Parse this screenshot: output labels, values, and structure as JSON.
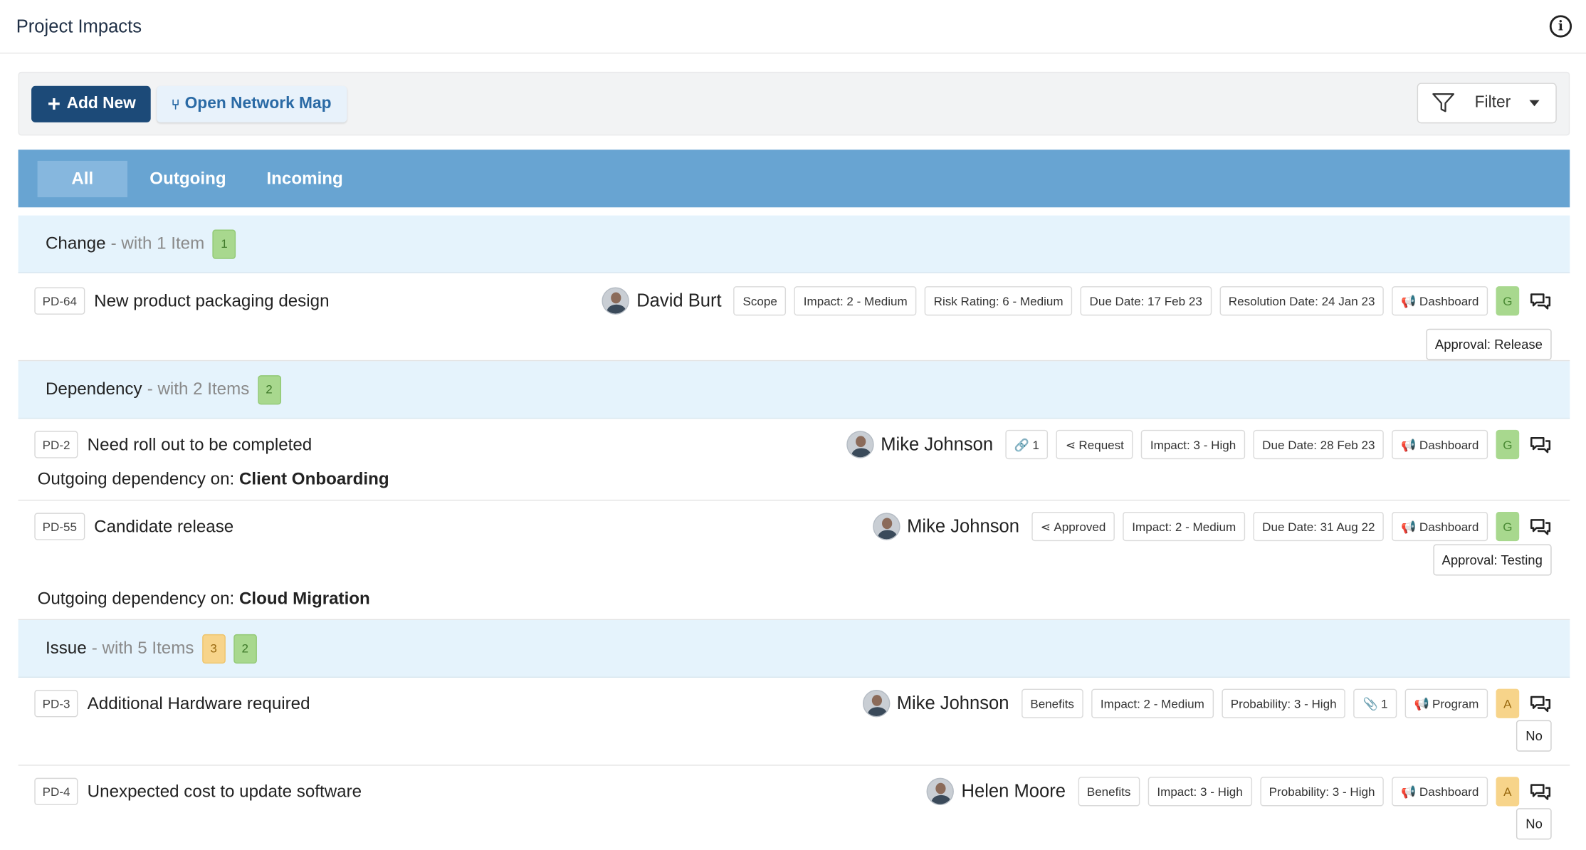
{
  "header": {
    "title": "Project Impacts"
  },
  "toolbar": {
    "add_label": "Add New",
    "map_label": "Open Network Map",
    "filter_label": "Filter"
  },
  "tabs": [
    {
      "label": "All"
    },
    {
      "label": "Outgoing"
    },
    {
      "label": "Incoming"
    }
  ],
  "groups": [
    {
      "name": "Change",
      "sub": "- with 1 Item",
      "counts": [
        "1"
      ]
    },
    {
      "name": "Dependency",
      "sub": "- with 2 Items",
      "counts": [
        "2"
      ]
    },
    {
      "name": "Issue",
      "sub": "- with 5 Items",
      "counts": [
        "3",
        "2"
      ]
    }
  ],
  "items": [
    {
      "id": "PD-64",
      "title": "New product packaging design",
      "owner": "David Burt",
      "tags": [
        "Scope",
        "Impact: 2 - Medium",
        "Risk Rating: 6 - Medium",
        "Due Date: 17 Feb 23",
        "Resolution Date: 24 Jan 23",
        "Dashboard"
      ],
      "rag": "G",
      "approval": "Approval: Release"
    },
    {
      "id": "PD-2",
      "title": "Need roll out to be completed",
      "owner": "Mike Johnson",
      "tags": [
        "1",
        "Request",
        "Impact: 3 - High",
        "Due Date: 28 Feb 23",
        "Dashboard"
      ],
      "rag": "G",
      "dep_prefix": "Outgoing dependency on:",
      "dep_target": "Client Onboarding"
    },
    {
      "id": "PD-55",
      "title": "Candidate release",
      "owner": "Mike Johnson",
      "tags": [
        "Approved",
        "Impact: 2 - Medium",
        "Due Date: 31 Aug 22",
        "Dashboard"
      ],
      "rag": "G",
      "approval": "Approval: Testing",
      "dep_prefix": "Outgoing dependency on:",
      "dep_target": "Cloud Migration"
    },
    {
      "id": "PD-3",
      "title": "Additional Hardware required",
      "owner": "Mike Johnson",
      "tags": [
        "Benefits",
        "Impact: 2 - Medium",
        "Probability: 3 - High",
        "1",
        "Program"
      ],
      "rag": "A",
      "approval": "No"
    },
    {
      "id": "PD-4",
      "title": "Unexpected cost to update software",
      "owner": "Helen Moore",
      "tags": [
        "Benefits",
        "Impact: 3 - High",
        "Probability: 3 - High",
        "Dashboard"
      ],
      "rag": "A",
      "approval": "No"
    }
  ],
  "colors": {
    "accent": "#1c4a78",
    "tabbar": "#68a4d2",
    "group_bg": "#e5f3fc",
    "rag_green": "#a8d88e",
    "rag_amber": "#f7d48a"
  },
  "icons": [
    "info-icon",
    "plus-icon",
    "branch-icon",
    "filter-icon",
    "chevron-down-icon",
    "link-icon",
    "share-icon",
    "megaphone-icon",
    "paperclip-icon",
    "chat-icon"
  ]
}
